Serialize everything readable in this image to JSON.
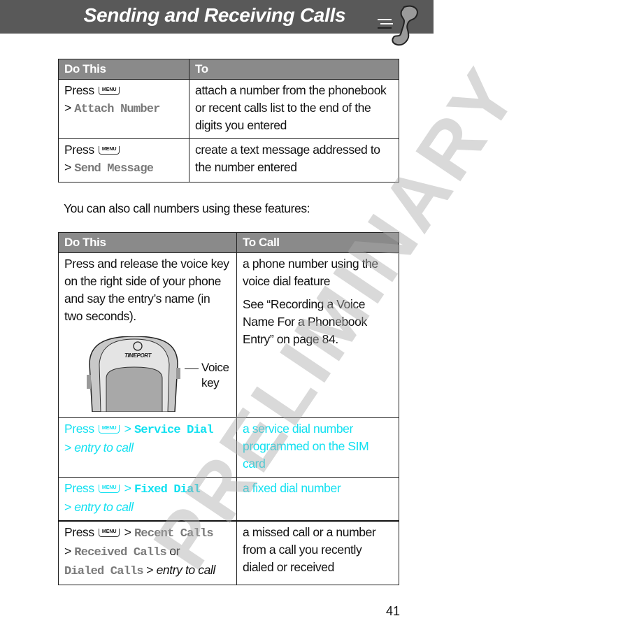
{
  "header": {
    "title": "Sending and Receiving Calls",
    "icon": "phone-handset-icon"
  },
  "table1": {
    "headers": [
      "Do This",
      "To"
    ],
    "rows": [
      {
        "press": "Press",
        "menu": "MENU",
        "gt": ">",
        "item": "Attach Number",
        "to": [
          "attach a number from the phonebook",
          "or recent calls list to the end of the",
          "digits you entered"
        ]
      },
      {
        "press": "Press",
        "menu": "MENU",
        "gt": ">",
        "item": "Send Message",
        "to": [
          "create a text message addressed to",
          "the number entered"
        ]
      }
    ]
  },
  "intro": "You can also call numbers using these features:",
  "table2": {
    "headers": [
      "Do This",
      "To Call"
    ],
    "voice": {
      "do": [
        "Press and release the voice key",
        "on the right side of your phone",
        "and say the entry’s name (in",
        "two seconds)."
      ],
      "to": [
        "a phone number using the",
        "voice dial feature"
      ],
      "see": [
        "See “Recording a Voice",
        "Name For a Phonebook",
        "Entry” on page 84."
      ],
      "brand": "TIMEPORT",
      "label1": "Voice",
      "label2": "key"
    },
    "service": {
      "press": "Press",
      "menu": "MENU",
      "gt": ">",
      "item": "Service Dial",
      "gt2": ">",
      "entry": "entry to call",
      "to": [
        "a service dial number",
        "programmed on the SIM",
        "card"
      ]
    },
    "fixed": {
      "press": "Press",
      "menu": "MENU",
      "gt": ">",
      "item": "Fixed Dial",
      "gt2": ">",
      "entry": "entry to call",
      "to": [
        "a fixed dial number"
      ]
    },
    "recent": {
      "press": "Press",
      "menu": "MENU",
      "gt": ">",
      "item": "Recent Calls",
      "gt2": ">",
      "item2": "Received Calls",
      "or": "or",
      "item3": "Dialed Calls",
      "gt3": ">",
      "entry": "entry to call",
      "to": [
        "a missed call or a number",
        "from a call you recently",
        "dialed or received"
      ]
    }
  },
  "watermark": "PRELIMINARY",
  "page_number": "41",
  "colors": {
    "header_bg": "#595959",
    "table_header_bg": "#8a8a8a",
    "highlight": "#12e0f0",
    "menu_item": "#7a7a7a"
  }
}
